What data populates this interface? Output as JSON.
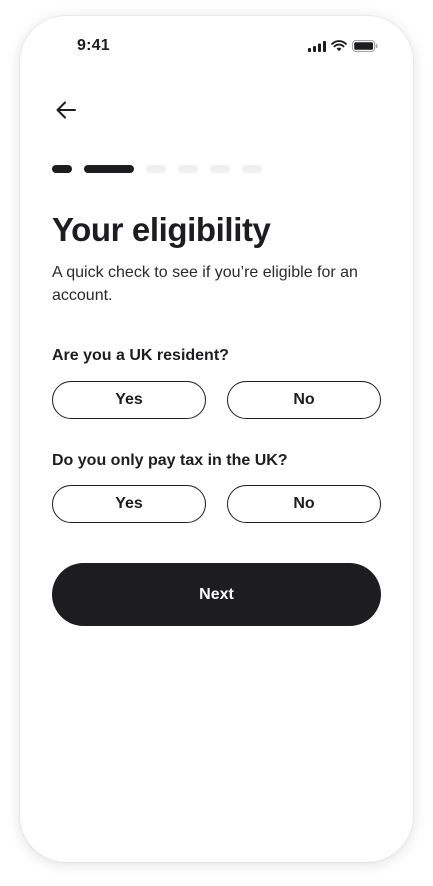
{
  "status_bar": {
    "time": "9:41",
    "icons": [
      "cellular-signal-icon",
      "wifi-icon",
      "battery-icon"
    ]
  },
  "navigation": {
    "back_icon": "arrow-left-icon"
  },
  "progress": {
    "total_steps": 7,
    "completed_steps": 2,
    "active_color": "#1d1d1f",
    "inactive_color": "#efeff1"
  },
  "page": {
    "title": "Your eligibility",
    "subtitle": "A quick check to see if you’re eligible for an account."
  },
  "questions": [
    {
      "label": "Are you a UK resident?",
      "options": [
        "Yes",
        "No"
      ]
    },
    {
      "label": "Do you only pay tax in the UK?",
      "options": [
        "Yes",
        "No"
      ]
    }
  ],
  "actions": {
    "next_label": "Next"
  },
  "colors": {
    "primary": "#1d1d1f",
    "background": "#ffffff"
  }
}
